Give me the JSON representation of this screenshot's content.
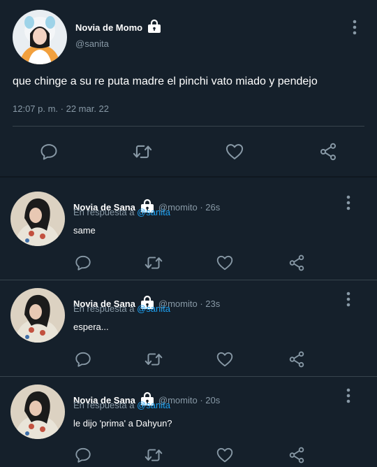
{
  "colors": {
    "background": "#15202b",
    "divider": "#38444d",
    "secondary_text": "#8899a6",
    "mention": "#1da1f2",
    "icon": "#8899a6"
  },
  "main_tweet": {
    "display_name": "Novia de Momo",
    "handle": "@sanita",
    "text": "que chinge a su re puta madre el pinchi vato miado y pendejo",
    "timestamp": "12:07 p. m. · 22 mar. 22",
    "icons": [
      "lock-icon",
      "more-vertical-icon",
      "reply-icon",
      "retweet-icon",
      "like-icon",
      "share-icon"
    ]
  },
  "replies": [
    {
      "display_name": "Novia de Sana",
      "handle": "@momito",
      "time": "26s",
      "reply_prefix": "En respuesta a",
      "reply_to": "@sanita",
      "text": "same"
    },
    {
      "display_name": "Novia de Sana",
      "handle": "@momito",
      "time": "23s",
      "reply_prefix": "En respuesta a",
      "reply_to": "@sanita",
      "text": "espera..."
    },
    {
      "display_name": "Novia de Sana",
      "handle": "@momito",
      "time": "20s",
      "reply_prefix": "En respuesta a",
      "reply_to": "@sanita",
      "text": "le dijo 'prima' a Dahyun?"
    }
  ]
}
